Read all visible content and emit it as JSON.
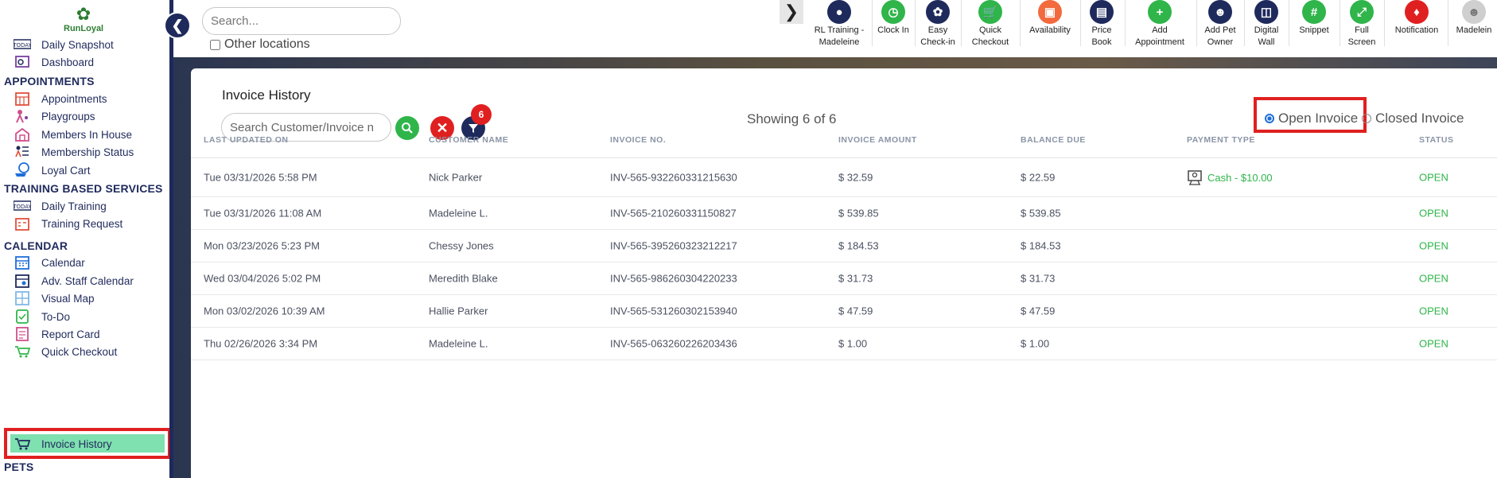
{
  "brand": {
    "name": "RunLoyal"
  },
  "sidebar": {
    "items": [
      {
        "label": "Daily Snapshot",
        "icon": "today-icon"
      },
      {
        "label": "Dashboard",
        "icon": "dashboard-icon"
      },
      {
        "label": "Appointments",
        "icon": "calendar-grid-icon"
      },
      {
        "label": "Playgroups",
        "icon": "playgroups-icon"
      },
      {
        "label": "Members In House",
        "icon": "house-icon"
      },
      {
        "label": "Membership Status",
        "icon": "membership-icon"
      },
      {
        "label": "Loyal Cart",
        "icon": "cart-icon"
      },
      {
        "label": "Daily Training",
        "icon": "today-icon"
      },
      {
        "label": "Training Request",
        "icon": "training-request-icon"
      },
      {
        "label": "Calendar",
        "icon": "calendar-icon"
      },
      {
        "label": "Adv. Staff Calendar",
        "icon": "staff-calendar-icon"
      },
      {
        "label": "Visual Map",
        "icon": "map-icon"
      },
      {
        "label": "To-Do",
        "icon": "todo-icon"
      },
      {
        "label": "Report Card",
        "icon": "report-card-icon"
      },
      {
        "label": "Quick Checkout",
        "icon": "quick-checkout-icon"
      },
      {
        "label": "Invoice History",
        "icon": "invoice-history-icon"
      }
    ],
    "sections": {
      "appointments": "APPOINTMENTS",
      "training": "TRAINING BASED SERVICES",
      "calendar": "CALENDAR",
      "pets": "PETS"
    }
  },
  "topbar": {
    "search_placeholder": "Search...",
    "other_locations": "Other locations",
    "toolbar": [
      {
        "label": "RL Training - Madeleine",
        "icon": "location-pin-icon",
        "color": "#1f2a5c"
      },
      {
        "label": "Clock In",
        "icon": "clock-icon",
        "color": "#2fb54a"
      },
      {
        "label": "Easy Check-in",
        "icon": "paw-icon",
        "color": "#1f2a5c"
      },
      {
        "label": "Quick Checkout",
        "icon": "cart-icon",
        "color": "#2fb54a"
      },
      {
        "label": "Availability",
        "icon": "availability-icon",
        "color": "#f26a3d"
      },
      {
        "label": "Price Book",
        "icon": "book-icon",
        "color": "#1f2a5c"
      },
      {
        "label": "Add Appointment",
        "icon": "add-appointment-icon",
        "color": "#2fb54a"
      },
      {
        "label": "Add Pet Owner",
        "icon": "add-user-icon",
        "color": "#1f2a5c"
      },
      {
        "label": "Digital Wall",
        "icon": "monitor-icon",
        "color": "#1f2a5c"
      },
      {
        "label": "Snippet",
        "icon": "hashtag-icon",
        "color": "#2fb54a"
      },
      {
        "label": "Full Screen",
        "icon": "fullscreen-icon",
        "color": "#2fb54a"
      },
      {
        "label": "Notification",
        "icon": "bell-icon",
        "color": "#e02020"
      },
      {
        "label": "Madelein",
        "icon": "avatar-icon",
        "color": "#aaaaaa"
      }
    ]
  },
  "invoice": {
    "title": "Invoice History",
    "search_placeholder": "Search Customer/Invoice n",
    "filter_count": "6",
    "showing": "Showing 6 of 6",
    "radio_open": "Open Invoice",
    "radio_closed": "Closed Invoice",
    "columns": [
      "LAST UPDATED ON",
      "CUSTOMER NAME",
      "INVOICE NO.",
      "INVOICE AMOUNT",
      "BALANCE DUE",
      "PAYMENT TYPE",
      "STATUS"
    ],
    "rows": [
      {
        "updated": "Tue 03/31/2026 5:58 PM",
        "customer": "Nick Parker",
        "invoice_no": "INV-565-932260331215630",
        "amount": "$ 32.59",
        "balance": "$ 22.59",
        "payment": "Cash - $10.00",
        "status": "OPEN"
      },
      {
        "updated": "Tue 03/31/2026 11:08 AM",
        "customer": "Madeleine L.",
        "invoice_no": "INV-565-210260331150827",
        "amount": "$ 539.85",
        "balance": "$ 539.85",
        "payment": "",
        "status": "OPEN"
      },
      {
        "updated": "Mon 03/23/2026 5:23 PM",
        "customer": "Chessy Jones",
        "invoice_no": "INV-565-395260323212217",
        "amount": "$ 184.53",
        "balance": "$ 184.53",
        "payment": "",
        "status": "OPEN"
      },
      {
        "updated": "Wed 03/04/2026 5:02 PM",
        "customer": "Meredith Blake",
        "invoice_no": "INV-565-986260304220233",
        "amount": "$ 31.73",
        "balance": "$ 31.73",
        "payment": "",
        "status": "OPEN"
      },
      {
        "updated": "Mon 03/02/2026 10:39 AM",
        "customer": "Hallie Parker",
        "invoice_no": "INV-565-531260302153940",
        "amount": "$ 47.59",
        "balance": "$ 47.59",
        "payment": "",
        "status": "OPEN"
      },
      {
        "updated": "Thu 02/26/2026 3:34 PM",
        "customer": "Madeleine L.",
        "invoice_no": "INV-565-063260226203436",
        "amount": "$ 1.00",
        "balance": "$ 1.00",
        "payment": "",
        "status": "OPEN"
      }
    ]
  },
  "colors": {
    "navy": "#1f2a5c",
    "green": "#2fb54a",
    "red": "#e02020",
    "active_bg": "#7fe0b0"
  }
}
